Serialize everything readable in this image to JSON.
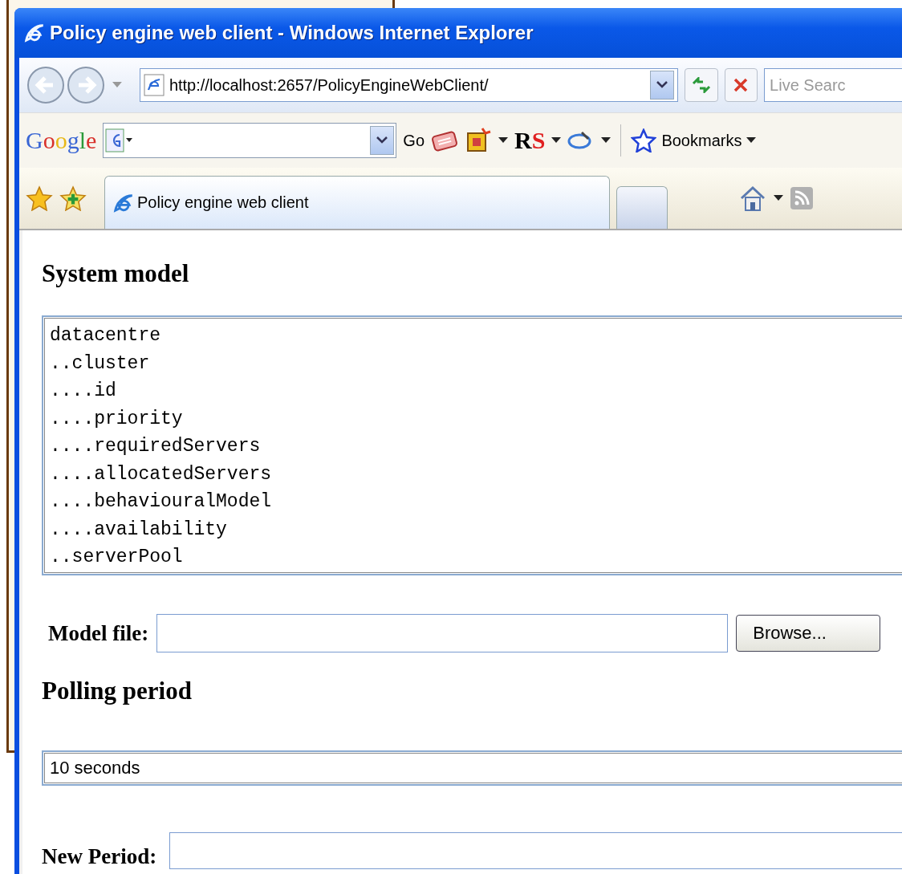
{
  "window": {
    "title": "Policy engine web client - Windows Internet Explorer"
  },
  "address_bar": {
    "url": "http://localhost:2657/PolicyEngineWebClient/"
  },
  "search": {
    "placeholder": "Live Searc"
  },
  "google_toolbar": {
    "logo": "Google",
    "go": "Go",
    "rs": "RS",
    "bookmarks": "Bookmarks"
  },
  "tabs": [
    {
      "label": "Policy engine web client",
      "selected": true
    }
  ],
  "page": {
    "system_model": {
      "heading": "System model",
      "items": [
        "datacentre",
        "..cluster",
        "....id",
        "....priority",
        "....requiredServers",
        "....allocatedServers",
        "....behaviouralModel",
        "....availability",
        "..serverPool"
      ]
    },
    "model_file": {
      "label": "Model file:",
      "browse": "Browse..."
    },
    "polling": {
      "heading": "Polling period",
      "value": "10 seconds"
    },
    "new_period": {
      "label": "New Period:"
    }
  }
}
